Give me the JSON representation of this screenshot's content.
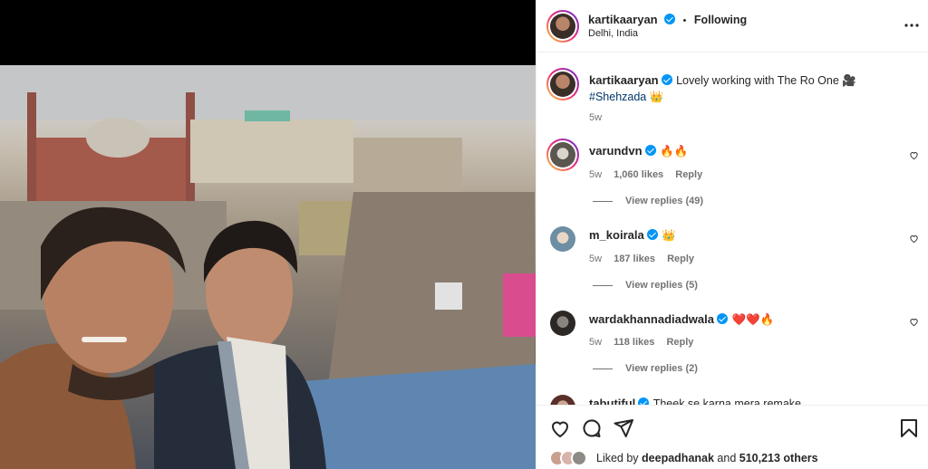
{
  "post": {
    "username": "kartikaaryan",
    "following_label": "Following",
    "separator": "•",
    "location": "Delhi, India",
    "more_icon": "more-options-icon"
  },
  "caption": {
    "username": "kartikaaryan",
    "text": "Lovely working with The Ro One 🎥",
    "hashtag": "#Shehzada 👑",
    "time": "5w"
  },
  "comments": [
    {
      "username": "varundvn",
      "text": "🔥🔥",
      "time": "5w",
      "likes": "1,060 likes",
      "reply": "Reply",
      "view_replies": "View replies (49)"
    },
    {
      "username": "m_koirala",
      "text": "👑",
      "time": "5w",
      "likes": "187 likes",
      "reply": "Reply",
      "view_replies": "View replies (5)"
    },
    {
      "username": "wardakhannadiadwala",
      "text": "❤️❤️🔥",
      "time": "5w",
      "likes": "118 likes",
      "reply": "Reply",
      "view_replies": "View replies (2)"
    },
    {
      "username": "tabutiful",
      "text": "Theek se karna mera remake"
    }
  ],
  "likes": {
    "prefix": "Liked by",
    "user": "deepadhanak",
    "and": "and",
    "count": "510,213 others"
  },
  "colors": {
    "verified": "#0095f6",
    "link": "#00376b",
    "muted": "#737373"
  }
}
